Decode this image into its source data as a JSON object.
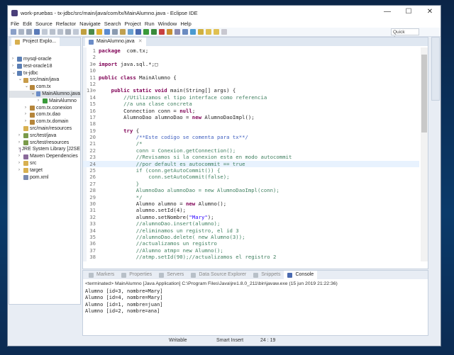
{
  "window": {
    "title": "work-pruebas - tx-jdbc/src/main/java/com/tx/MainAlumno.java - Eclipse IDE",
    "controls": [
      "—",
      "☐",
      "✕"
    ]
  },
  "menu": [
    "File",
    "Edit",
    "Source",
    "Refactor",
    "Navigate",
    "Search",
    "Project",
    "Run",
    "Window",
    "Help"
  ],
  "toolbar": {
    "quick_access": "Quick Access"
  },
  "explorer": {
    "tab": "Project Explo...",
    "items": [
      {
        "label": "mysql-oracle",
        "depth": 0,
        "twisty": "›",
        "icon": "project",
        "color": "#5b7fb5"
      },
      {
        "label": "test-oracle18",
        "depth": 0,
        "twisty": "›",
        "icon": "project",
        "color": "#5b7fb5"
      },
      {
        "label": "tx-jdbc",
        "depth": 0,
        "twisty": "⌄",
        "icon": "project",
        "color": "#5b7fb5"
      },
      {
        "label": "src/main/java",
        "depth": 1,
        "twisty": "⌄",
        "icon": "source-folder",
        "color": "#c89c4a"
      },
      {
        "label": "com.tx",
        "depth": 2,
        "twisty": "⌄",
        "icon": "package",
        "color": "#b5853a"
      },
      {
        "label": "MainAlumno.java",
        "depth": 3,
        "twisty": "⌄",
        "icon": "java-file",
        "color": "#6b8cc7",
        "selected": true
      },
      {
        "label": "MainAlumno",
        "depth": 4,
        "twisty": "›",
        "icon": "class",
        "color": "#3a9a3a"
      },
      {
        "label": "com.tx.conexion",
        "depth": 2,
        "twisty": "›",
        "icon": "package",
        "color": "#b5853a"
      },
      {
        "label": "com.tx.dao",
        "depth": 2,
        "twisty": "›",
        "icon": "package",
        "color": "#b5853a"
      },
      {
        "label": "com.tx.domain",
        "depth": 2,
        "twisty": "›",
        "icon": "package",
        "color": "#b5853a"
      },
      {
        "label": "src/main/resources",
        "depth": 1,
        "twisty": "",
        "icon": "folder",
        "color": "#d8b050"
      },
      {
        "label": "src/test/java",
        "depth": 1,
        "twisty": "›",
        "icon": "source-folder",
        "color": "#7a9a4a"
      },
      {
        "label": "src/test/resources",
        "depth": 1,
        "twisty": "›",
        "icon": "source-folder",
        "color": "#7a9a4a"
      },
      {
        "label": "JRE System Library [J2SE",
        "depth": 1,
        "twisty": "›",
        "icon": "library",
        "color": "#8a6a9a"
      },
      {
        "label": "Maven Dependencies",
        "depth": 1,
        "twisty": "›",
        "icon": "library",
        "color": "#8a6a9a"
      },
      {
        "label": "src",
        "depth": 1,
        "twisty": "›",
        "icon": "folder",
        "color": "#d8b050"
      },
      {
        "label": "target",
        "depth": 1,
        "twisty": "›",
        "icon": "folder",
        "color": "#d8b050"
      },
      {
        "label": "pom.xml",
        "depth": 1,
        "twisty": "",
        "icon": "xml-file",
        "color": "#7a8ab0"
      }
    ]
  },
  "editor": {
    "tab": "MainAlumno.java",
    "lines": [
      {
        "n": "1",
        "t": [
          [
            "kw",
            "package"
          ],
          [
            "",
            "  com.tx;"
          ]
        ]
      },
      {
        "n": "2",
        "t": []
      },
      {
        "n": "3⊕",
        "t": [
          [
            "kw",
            "import"
          ],
          [
            "",
            " java.sql.*;□"
          ]
        ]
      },
      {
        "n": "10",
        "t": []
      },
      {
        "n": "11",
        "t": [
          [
            "kw",
            "public class"
          ],
          [
            "",
            " MainAlumno {"
          ]
        ]
      },
      {
        "n": "12",
        "t": []
      },
      {
        "n": "13⊖",
        "t": [
          [
            "",
            "    "
          ],
          [
            "kw",
            "public static void"
          ],
          [
            "",
            " main(String[] args) {"
          ]
        ]
      },
      {
        "n": "14",
        "t": [
          [
            "cm",
            "        //Utilizamos el tipo interface como referencia"
          ]
        ]
      },
      {
        "n": "15",
        "t": [
          [
            "cm",
            "        //a una clase concreta"
          ]
        ]
      },
      {
        "n": "16",
        "t": [
          [
            "",
            "        Connection conn = "
          ],
          [
            "kw",
            "null"
          ],
          [
            "",
            ";"
          ]
        ]
      },
      {
        "n": "17",
        "t": [
          [
            "",
            "        AlumnoDao alumnoDao = "
          ],
          [
            "kw",
            "new"
          ],
          [
            "",
            " AlumnoDaoImpl();"
          ]
        ]
      },
      {
        "n": "18",
        "t": []
      },
      {
        "n": "19",
        "t": [
          [
            "",
            "        "
          ],
          [
            "kw",
            "try"
          ],
          [
            "",
            " {"
          ]
        ]
      },
      {
        "n": "20",
        "t": [
          [
            "jd",
            "            /**Este codigo se comenta para tx**/"
          ]
        ]
      },
      {
        "n": "21",
        "t": [
          [
            "cm",
            "            /*"
          ]
        ]
      },
      {
        "n": "22",
        "t": [
          [
            "cm",
            "            conn = Conexion.getConnection();"
          ]
        ]
      },
      {
        "n": "23",
        "t": [
          [
            "cm",
            "            //Revisamos si la conexion esta en modo autocommit"
          ]
        ]
      },
      {
        "n": "24",
        "t": [
          [
            "cm",
            "            //por default es autocommit == true"
          ]
        ],
        "current": true
      },
      {
        "n": "25",
        "t": [
          [
            "cm",
            "            if (conn.getAutoCommit()) {"
          ]
        ]
      },
      {
        "n": "26",
        "t": [
          [
            "cm",
            "                conn.setAutoCommit(false);"
          ]
        ]
      },
      {
        "n": "27",
        "t": [
          [
            "cm",
            "            }"
          ]
        ]
      },
      {
        "n": "28",
        "t": [
          [
            "cm",
            "            AlumnoDao alumnoDao = new AlumnoDaoImpl(conn);"
          ]
        ]
      },
      {
        "n": "29",
        "t": [
          [
            "cm",
            "            */"
          ]
        ]
      },
      {
        "n": "30",
        "t": [
          [
            "",
            "            Alumno alumno = "
          ],
          [
            "kw",
            "new"
          ],
          [
            "",
            " Alumno();"
          ]
        ]
      },
      {
        "n": "31",
        "t": [
          [
            "",
            "            alumno.setId(4);"
          ]
        ]
      },
      {
        "n": "32",
        "t": [
          [
            "",
            "            alumno.setNombre("
          ],
          [
            "st",
            "\"Mary\""
          ],
          [
            "",
            ");"
          ]
        ]
      },
      {
        "n": "33",
        "t": [
          [
            "cm",
            "            //alumnoDao.insert(alumno);"
          ]
        ]
      },
      {
        "n": "34",
        "t": [
          [
            "cm",
            "            //eliminamos un registro, el id 3"
          ]
        ]
      },
      {
        "n": "35",
        "t": [
          [
            "cm",
            "            //alumnoDao.delete( new Alumno(3));"
          ]
        ]
      },
      {
        "n": "36",
        "t": [
          [
            "cm",
            "            //actualizamos un registro"
          ]
        ]
      },
      {
        "n": "37",
        "t": [
          [
            "cm",
            "            //Alumno atmp= new Alumno();"
          ]
        ]
      },
      {
        "n": "38",
        "t": [
          [
            "cm",
            "            //atmp.setId(90);//actualizamos el registro 2"
          ]
        ]
      }
    ]
  },
  "bottom": {
    "tabs": [
      "Markers",
      "Properties",
      "Servers",
      "Data Source Explorer",
      "Snippets",
      "Console"
    ],
    "terminated": "<terminated> MainAlumno [Java Application] C:\\Program Files\\Java\\jre1.8.0_211\\bin\\javaw.exe (15 jun 2019 21:22:36)",
    "output": [
      "Alumno [id=3, nombre=Mary]",
      "Alumno [id=4, nombre=Mary]",
      "Alumno [id=1, nombre=juan]",
      "Alumno [id=2, nombre=ana]"
    ]
  },
  "status": {
    "writable": "Writable",
    "insert": "Smart Insert",
    "position": "24 : 19"
  }
}
